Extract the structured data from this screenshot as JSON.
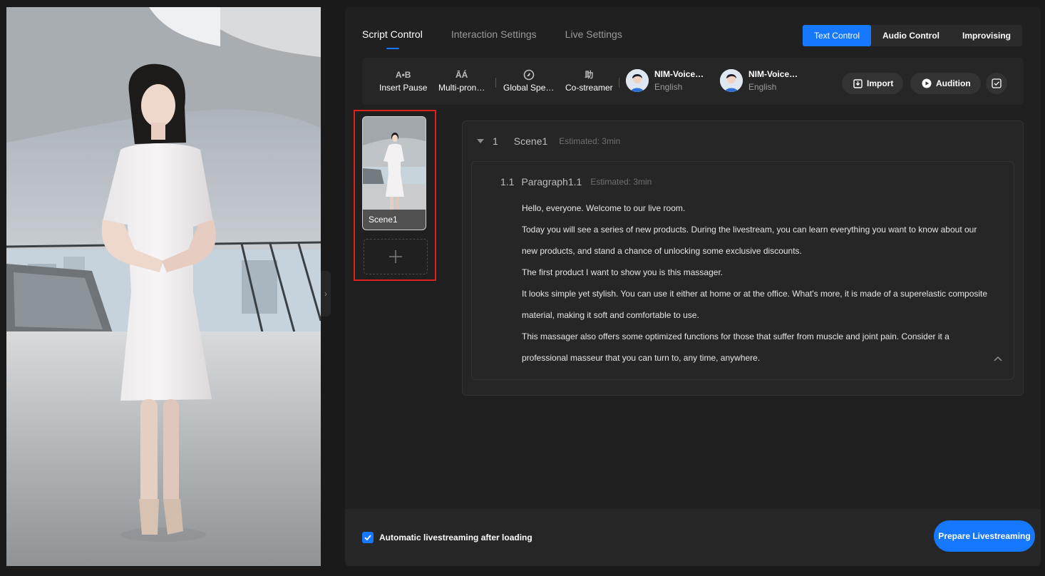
{
  "tabs": [
    {
      "label": "Script Control",
      "active": true
    },
    {
      "label": "Interaction Settings",
      "active": false
    },
    {
      "label": "Live Settings",
      "active": false
    }
  ],
  "mode_switch": [
    {
      "label": "Text Control",
      "active": true
    },
    {
      "label": "Audio Control",
      "active": false
    },
    {
      "label": "Improvising",
      "active": false
    }
  ],
  "toolbar": {
    "tools": [
      {
        "icon": "ab-pause-icon",
        "glyph": "A•B",
        "label": "Insert Pause"
      },
      {
        "icon": "multi-pronunciation-icon",
        "glyph": "ĀÁ",
        "label": "Multi-pron…"
      },
      {
        "icon": "global-speed-icon",
        "glyph": "",
        "label": "Global Spe…"
      },
      {
        "icon": "co-streamer-icon",
        "glyph": "助",
        "label": "Co-streamer"
      }
    ],
    "voices": [
      {
        "name": "NIM-Voice…",
        "language": "English"
      },
      {
        "name": "NIM-Voice…",
        "language": "English"
      }
    ],
    "import_label": "Import",
    "audition_label": "Audition"
  },
  "scenes": [
    {
      "label": "Scene1"
    }
  ],
  "script": {
    "scene_number": "1",
    "scene_name": "Scene1",
    "scene_estimate": "Estimated: 3min",
    "paragraph_number": "1.1",
    "paragraph_name": "Paragraph1.1",
    "paragraph_estimate": "Estimated: 3min",
    "lines": [
      "Hello, everyone. Welcome to our live room.",
      "Today you will see a series of new products. During the livestream, you can learn everything you want to know about our",
      "new products, and stand a chance of unlocking some exclusive discounts.",
      "The first product I want to show you is this massager.",
      "It looks simple yet stylish. You can use it either at home or at the office. What's more, it is made of a superelastic composite",
      "material, making it soft and comfortable to use.",
      "This massager also offers some optimized functions for those that suffer from muscle and joint pain. Consider it a",
      "professional masseur that you can turn to, any time, anywhere."
    ]
  },
  "footer": {
    "auto_live_label": "Automatic livestreaming after loading",
    "auto_live_checked": true,
    "prepare_label": "Prepare Livestreaming"
  },
  "colors": {
    "accent": "#1677ff",
    "highlight_border": "#e0201b",
    "panel_bg": "#202020"
  }
}
